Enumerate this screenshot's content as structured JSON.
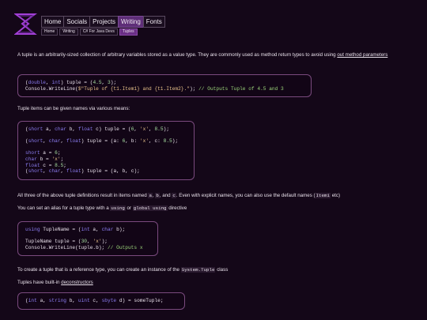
{
  "nav": {
    "items": [
      "Home",
      "Socials",
      "Projects",
      "Writing",
      "Fonts"
    ],
    "active": "Writing"
  },
  "breadcrumb": [
    "Home",
    "Writing",
    "C# For Java Devs",
    "Tuples"
  ],
  "content": {
    "p1_text": "A tuple is an arbitrarily-sized collection of arbitrary variables stored as a value type. They are commonly used as method return types to avoid using ",
    "p1_link": "out method parameters",
    "code1": [
      "(double, int) tuple = (4.5, 3);",
      "Console.WriteLine($\"Tuple of {t1.Item1} and {t1.Item2}.\"); // Outputs Tuple of 4.5 and 3"
    ],
    "p2": "Tuple items can be given names via various means:",
    "code2": [
      "(short a, char b, float c) tuple = (6, 'x', 8.5);",
      "",
      "(short, char, float) tuple = (a: 6, b: 'x', c: 8.5);",
      "",
      "short a = 6;",
      "char b = 'x';",
      "float c = 8.5;",
      "(short, char, float) tuple = (a, b, c);"
    ],
    "p3_a": "All three of the above tuple definitions result in items named ",
    "p3_codes": [
      "a",
      "b",
      "c",
      "Item1"
    ],
    "p3_b": ", ",
    "p3_c": ", and ",
    "p3_d": ". Even with explicit names, you can also use the default names (",
    "p3_e": " etc)",
    "p4_a": "You can set an alias for a tuple type with a ",
    "p4_code1": "using",
    "p4_b": " or ",
    "p4_code2": "global using",
    "p4_c": " directive",
    "code3": [
      "using TupleName = (int a, char b);",
      "",
      "TupleName tuple = (30, 'x');",
      "Console.WriteLine(tuple.b); // Outputs x"
    ],
    "p5_a": "To create a tuple that is a reference type, you can create an instance of the ",
    "p5_code": "System.Tuple",
    "p5_b": " class",
    "p6_a": "Tuples have built-in ",
    "p6_link": "deconstructors",
    "code4": [
      "(int a, string b, uint c, sbyte d) = someTuple;"
    ]
  },
  "colors": {
    "background": "#140718",
    "accent": "#5e2e78",
    "code_border": "#7a4a7e",
    "keyword": "#8a7cf0"
  },
  "icons": [
    "logo-hourglass-icon"
  ]
}
